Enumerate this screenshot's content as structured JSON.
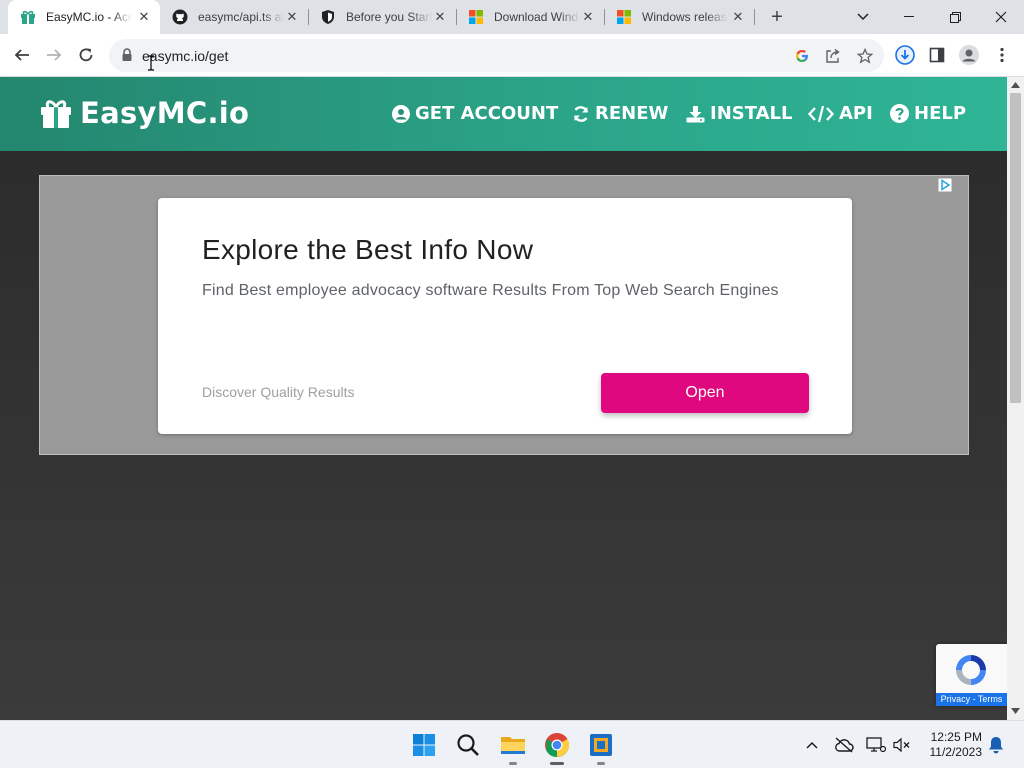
{
  "browser": {
    "tabs": [
      {
        "title": "EasyMC.io - Account",
        "icon": "gift-icon",
        "active": true
      },
      {
        "title": "easymc/api.ts at main",
        "icon": "github-icon",
        "active": false
      },
      {
        "title": "Before you Start",
        "icon": "shield-icon",
        "active": false
      },
      {
        "title": "Download Windows",
        "icon": "windows-icon",
        "active": false
      },
      {
        "title": "Windows release",
        "icon": "windows-icon",
        "active": false
      }
    ],
    "url": "easymc.io/get"
  },
  "site": {
    "logo_text": "EasyMC.io",
    "nav": [
      {
        "label": "GET ACCOUNT",
        "icon": "user-circle-icon"
      },
      {
        "label": "RENEW",
        "icon": "refresh-icon"
      },
      {
        "label": "INSTALL",
        "icon": "download-icon"
      },
      {
        "label": "API",
        "icon": "code-icon"
      },
      {
        "label": "HELP",
        "icon": "question-circle-icon"
      }
    ],
    "accent": "#2ba488"
  },
  "ad": {
    "title": "Explore the Best Info Now",
    "subtitle": "Find Best employee advocacy software Results From Top Web Search Engines",
    "footer": "Discover Quality Results",
    "button": "Open",
    "button_color": "#e0087e"
  },
  "recaptcha": {
    "links": "Privacy - Terms"
  },
  "taskbar": {
    "apps": [
      "start-icon",
      "search-icon",
      "file-explorer-icon",
      "chrome-icon",
      "virtualbox-icon"
    ],
    "time": "12:25 PM",
    "date": "11/2/2023"
  }
}
